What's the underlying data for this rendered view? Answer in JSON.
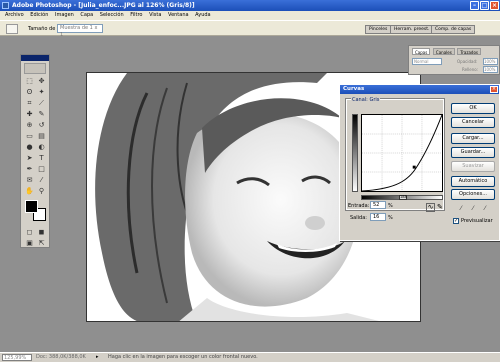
{
  "title": "Adobe Photoshop - [Julia_enfoc...JPG al 126% (Gris/8)]",
  "menu": [
    "Archivo",
    "Edición",
    "Imagen",
    "Capa",
    "Selección",
    "Filtro",
    "Vista",
    "Ventana",
    "Ayuda"
  ],
  "options": {
    "sample_label": "Tamaño de muestra:",
    "sample_value": "Muestra de 1 x 1"
  },
  "dock_tabs": [
    "Pinceles",
    "Herram. preest.",
    "Comp. de capas"
  ],
  "layers": {
    "tabs": [
      "Capas",
      "Canales",
      "Trazados"
    ],
    "mode": "Normal",
    "opacity_label": "Opacidad:",
    "opacity": "100%",
    "fill_label": "Relleno:",
    "fill": "100%"
  },
  "curves": {
    "title": "Curvas",
    "channel_label": "Canal:",
    "channel": "Gris",
    "input_label": "Entrada:",
    "input": "52",
    "output_label": "Salida:",
    "output": "16",
    "percent": "%",
    "slider_value": "188",
    "buttons": [
      "OK",
      "Cancelar",
      "Cargar...",
      "Guardar...",
      "Suavizar",
      "Automático",
      "Opciones..."
    ],
    "preview_label": "Previsualizar",
    "preview_checked": true
  },
  "status": {
    "zoom": "125,99%",
    "doc": "Doc: 388,0K/388,0K",
    "hint": "Haga clic en la imagen para escoger un color frontal nuevo."
  },
  "colors": {
    "titlebar": "#1c4fb8",
    "chrome": "#d4d0c8",
    "workspace": "#8f8f8f"
  }
}
